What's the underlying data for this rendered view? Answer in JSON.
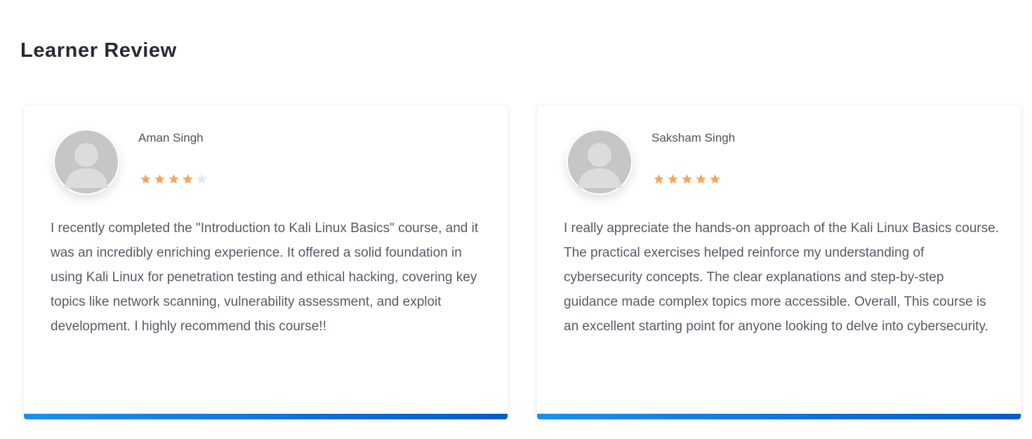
{
  "section": {
    "title": "Learner Review"
  },
  "colors": {
    "star_filled": "#f6a55a",
    "star_empty": "#dde7f0",
    "accent_bar_start": "#1e8fef",
    "accent_bar_end": "#0b5bc4"
  },
  "reviews": [
    {
      "name": "Aman Singh",
      "avatar_icon": "default-user-avatar-icon",
      "rating": 4,
      "rating_max": 5,
      "text": "I recently completed the \"Introduction to Kali Linux Basics\" course, and it was an incredibly enriching experience. It offered a solid foundation in using Kali Linux for penetration testing and ethical hacking, covering key topics like network scanning, vulnerability assessment, and exploit development. I highly recommend this course!!"
    },
    {
      "name": "Saksham Singh",
      "avatar_icon": "default-user-avatar-icon",
      "rating": 5,
      "rating_max": 5,
      "text": "I really appreciate the hands-on approach of the Kali Linux Basics course. The practical exercises helped reinforce my understanding of cybersecurity concepts. The clear explanations and step-by-step guidance made complex topics more accessible. Overall, This course is an excellent starting point for anyone looking to delve into cybersecurity."
    }
  ]
}
